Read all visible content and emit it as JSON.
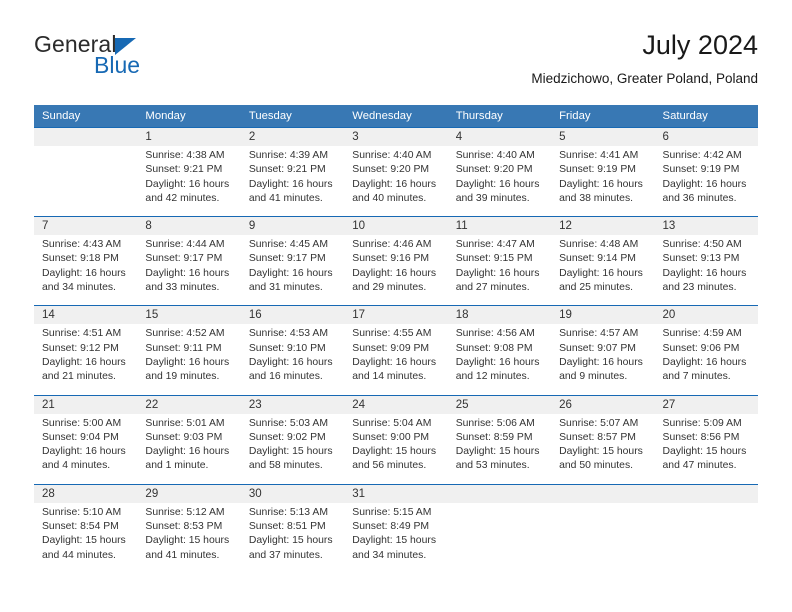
{
  "logo": {
    "word1": "General",
    "word2": "Blue",
    "triangle_color": "#1769b4",
    "text_color": "#2b2b2b"
  },
  "header": {
    "title": "July 2024",
    "subtitle": "Miedzichowo, Greater Poland, Poland"
  },
  "theme": {
    "header_bg": "#3878b4",
    "header_text": "#ffffff",
    "week_separator": "#1769b4",
    "daynum_bg": "#f0f0f0",
    "body_text": "#333333"
  },
  "weekday_headers": [
    "Sunday",
    "Monday",
    "Tuesday",
    "Wednesday",
    "Thursday",
    "Friday",
    "Saturday"
  ],
  "weeks": [
    [
      {
        "day": "",
        "lines": []
      },
      {
        "day": "1",
        "lines": [
          "Sunrise: 4:38 AM",
          "Sunset: 9:21 PM",
          "Daylight: 16 hours",
          "and 42 minutes."
        ]
      },
      {
        "day": "2",
        "lines": [
          "Sunrise: 4:39 AM",
          "Sunset: 9:21 PM",
          "Daylight: 16 hours",
          "and 41 minutes."
        ]
      },
      {
        "day": "3",
        "lines": [
          "Sunrise: 4:40 AM",
          "Sunset: 9:20 PM",
          "Daylight: 16 hours",
          "and 40 minutes."
        ]
      },
      {
        "day": "4",
        "lines": [
          "Sunrise: 4:40 AM",
          "Sunset: 9:20 PM",
          "Daylight: 16 hours",
          "and 39 minutes."
        ]
      },
      {
        "day": "5",
        "lines": [
          "Sunrise: 4:41 AM",
          "Sunset: 9:19 PM",
          "Daylight: 16 hours",
          "and 38 minutes."
        ]
      },
      {
        "day": "6",
        "lines": [
          "Sunrise: 4:42 AM",
          "Sunset: 9:19 PM",
          "Daylight: 16 hours",
          "and 36 minutes."
        ]
      }
    ],
    [
      {
        "day": "7",
        "lines": [
          "Sunrise: 4:43 AM",
          "Sunset: 9:18 PM",
          "Daylight: 16 hours",
          "and 34 minutes."
        ]
      },
      {
        "day": "8",
        "lines": [
          "Sunrise: 4:44 AM",
          "Sunset: 9:17 PM",
          "Daylight: 16 hours",
          "and 33 minutes."
        ]
      },
      {
        "day": "9",
        "lines": [
          "Sunrise: 4:45 AM",
          "Sunset: 9:17 PM",
          "Daylight: 16 hours",
          "and 31 minutes."
        ]
      },
      {
        "day": "10",
        "lines": [
          "Sunrise: 4:46 AM",
          "Sunset: 9:16 PM",
          "Daylight: 16 hours",
          "and 29 minutes."
        ]
      },
      {
        "day": "11",
        "lines": [
          "Sunrise: 4:47 AM",
          "Sunset: 9:15 PM",
          "Daylight: 16 hours",
          "and 27 minutes."
        ]
      },
      {
        "day": "12",
        "lines": [
          "Sunrise: 4:48 AM",
          "Sunset: 9:14 PM",
          "Daylight: 16 hours",
          "and 25 minutes."
        ]
      },
      {
        "day": "13",
        "lines": [
          "Sunrise: 4:50 AM",
          "Sunset: 9:13 PM",
          "Daylight: 16 hours",
          "and 23 minutes."
        ]
      }
    ],
    [
      {
        "day": "14",
        "lines": [
          "Sunrise: 4:51 AM",
          "Sunset: 9:12 PM",
          "Daylight: 16 hours",
          "and 21 minutes."
        ]
      },
      {
        "day": "15",
        "lines": [
          "Sunrise: 4:52 AM",
          "Sunset: 9:11 PM",
          "Daylight: 16 hours",
          "and 19 minutes."
        ]
      },
      {
        "day": "16",
        "lines": [
          "Sunrise: 4:53 AM",
          "Sunset: 9:10 PM",
          "Daylight: 16 hours",
          "and 16 minutes."
        ]
      },
      {
        "day": "17",
        "lines": [
          "Sunrise: 4:55 AM",
          "Sunset: 9:09 PM",
          "Daylight: 16 hours",
          "and 14 minutes."
        ]
      },
      {
        "day": "18",
        "lines": [
          "Sunrise: 4:56 AM",
          "Sunset: 9:08 PM",
          "Daylight: 16 hours",
          "and 12 minutes."
        ]
      },
      {
        "day": "19",
        "lines": [
          "Sunrise: 4:57 AM",
          "Sunset: 9:07 PM",
          "Daylight: 16 hours",
          "and 9 minutes."
        ]
      },
      {
        "day": "20",
        "lines": [
          "Sunrise: 4:59 AM",
          "Sunset: 9:06 PM",
          "Daylight: 16 hours",
          "and 7 minutes."
        ]
      }
    ],
    [
      {
        "day": "21",
        "lines": [
          "Sunrise: 5:00 AM",
          "Sunset: 9:04 PM",
          "Daylight: 16 hours",
          "and 4 minutes."
        ]
      },
      {
        "day": "22",
        "lines": [
          "Sunrise: 5:01 AM",
          "Sunset: 9:03 PM",
          "Daylight: 16 hours",
          "and 1 minute."
        ]
      },
      {
        "day": "23",
        "lines": [
          "Sunrise: 5:03 AM",
          "Sunset: 9:02 PM",
          "Daylight: 15 hours",
          "and 58 minutes."
        ]
      },
      {
        "day": "24",
        "lines": [
          "Sunrise: 5:04 AM",
          "Sunset: 9:00 PM",
          "Daylight: 15 hours",
          "and 56 minutes."
        ]
      },
      {
        "day": "25",
        "lines": [
          "Sunrise: 5:06 AM",
          "Sunset: 8:59 PM",
          "Daylight: 15 hours",
          "and 53 minutes."
        ]
      },
      {
        "day": "26",
        "lines": [
          "Sunrise: 5:07 AM",
          "Sunset: 8:57 PM",
          "Daylight: 15 hours",
          "and 50 minutes."
        ]
      },
      {
        "day": "27",
        "lines": [
          "Sunrise: 5:09 AM",
          "Sunset: 8:56 PM",
          "Daylight: 15 hours",
          "and 47 minutes."
        ]
      }
    ],
    [
      {
        "day": "28",
        "lines": [
          "Sunrise: 5:10 AM",
          "Sunset: 8:54 PM",
          "Daylight: 15 hours",
          "and 44 minutes."
        ]
      },
      {
        "day": "29",
        "lines": [
          "Sunrise: 5:12 AM",
          "Sunset: 8:53 PM",
          "Daylight: 15 hours",
          "and 41 minutes."
        ]
      },
      {
        "day": "30",
        "lines": [
          "Sunrise: 5:13 AM",
          "Sunset: 8:51 PM",
          "Daylight: 15 hours",
          "and 37 minutes."
        ]
      },
      {
        "day": "31",
        "lines": [
          "Sunrise: 5:15 AM",
          "Sunset: 8:49 PM",
          "Daylight: 15 hours",
          "and 34 minutes."
        ]
      },
      {
        "day": "",
        "lines": []
      },
      {
        "day": "",
        "lines": []
      },
      {
        "day": "",
        "lines": []
      }
    ]
  ]
}
